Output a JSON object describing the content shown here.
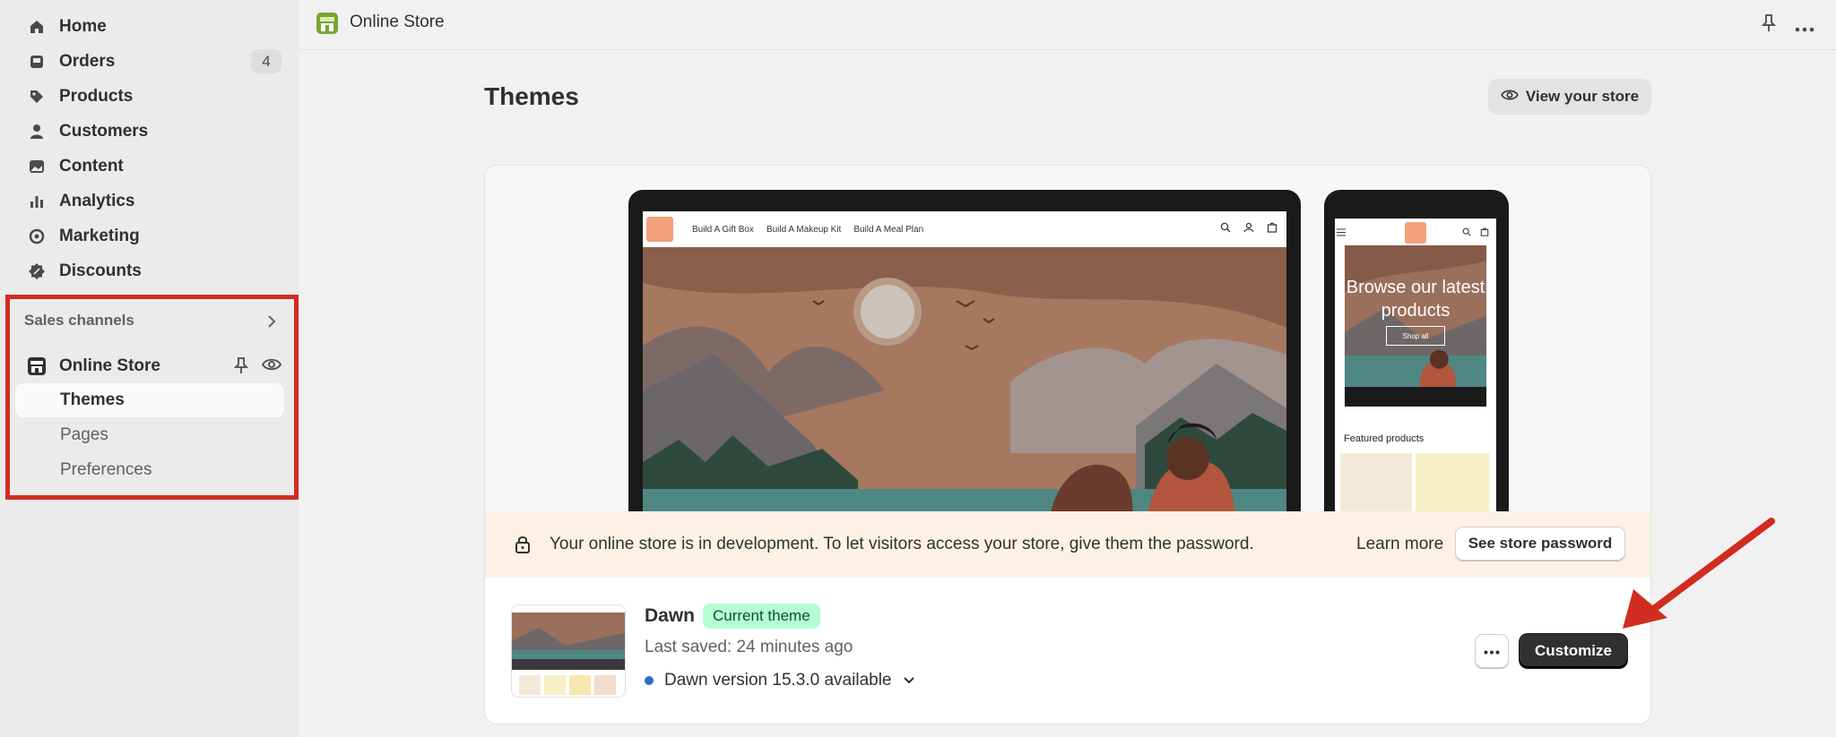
{
  "sidebar": {
    "items": [
      {
        "label": "Home",
        "icon": "home-icon"
      },
      {
        "label": "Orders",
        "icon": "orders-icon",
        "badge": "4"
      },
      {
        "label": "Products",
        "icon": "tag-icon"
      },
      {
        "label": "Customers",
        "icon": "person-icon"
      },
      {
        "label": "Content",
        "icon": "image-icon"
      },
      {
        "label": "Analytics",
        "icon": "bar-chart-icon"
      },
      {
        "label": "Marketing",
        "icon": "target-icon"
      },
      {
        "label": "Discounts",
        "icon": "discount-icon"
      }
    ],
    "sales_channels": {
      "title": "Sales channels",
      "online_store": "Online Store",
      "sub": [
        "Themes",
        "Pages",
        "Preferences"
      ]
    }
  },
  "topbar": {
    "title": "Online Store"
  },
  "main": {
    "title": "Themes",
    "view_store": "View your store",
    "preview": {
      "nav": [
        "Build A Gift Box",
        "Build A Makeup Kit",
        "Build A Meal Plan"
      ],
      "mobile_hero": "Browse our latest products",
      "mobile_button": "Shop all",
      "featured": "Featured products"
    },
    "banner": {
      "message": "Your online store is in development. To let visitors access your store, give them the password.",
      "learn_more": "Learn more",
      "see_password": "See store password"
    },
    "theme": {
      "name": "Dawn",
      "badge": "Current theme",
      "saved": "Last saved: 24 minutes ago",
      "version": "Dawn version 15.3.0 available",
      "customize": "Customize"
    }
  },
  "colors": {
    "annotation_red": "#d12c20",
    "accent_blue": "#2c6ecb",
    "badge_green": "#b4fed2"
  }
}
